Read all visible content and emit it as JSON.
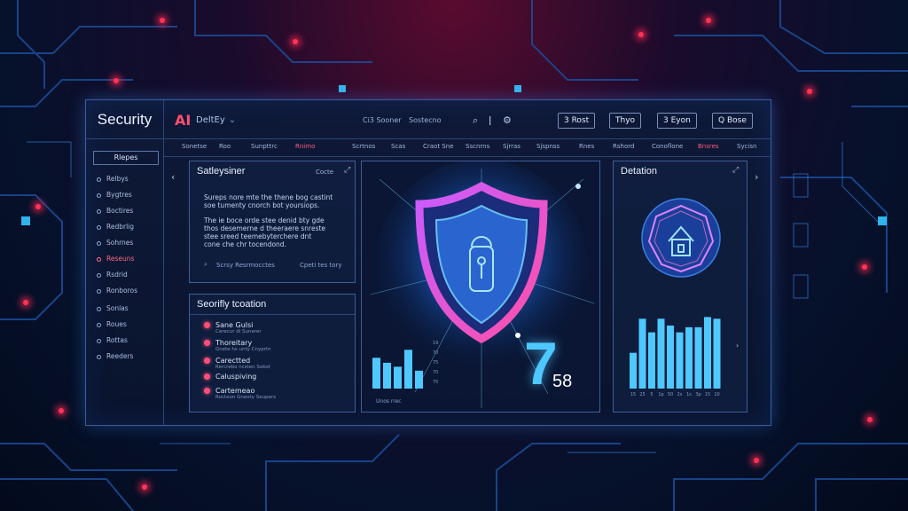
{
  "app": {
    "title": "Security",
    "ai_badge": "AI",
    "department": "DeltEy"
  },
  "topbar": {
    "mini_labels": [
      "Ci3 Sooner",
      "Sostecno"
    ],
    "icons": [
      "search-icon",
      "info-icon",
      "settings-icon"
    ],
    "buttons": [
      "3 Rost",
      "Thyo",
      "3 Eyon",
      "Q Bose"
    ]
  },
  "nav": {
    "items": [
      "Sonetse",
      "Roo",
      "Sunpttrc",
      "Rnimo",
      "Scrtnos",
      "Scas",
      "Craot Sne",
      "Sscnrns",
      "Sjrras",
      "Sjspnss",
      "Rnes",
      "Rshord",
      "Conoflone",
      "Bnsres",
      "Sycisn"
    ],
    "active_index": 3
  },
  "sidebar": {
    "header": "Rlepes",
    "items": [
      "Relbys",
      "Bygtres",
      "Boctires",
      "Redbrlig",
      "Sohrnes",
      "Reseuns",
      "Rsdrid",
      "Ronboros",
      "Sonlas",
      "Roues",
      "Rottas",
      "Reeders"
    ],
    "active_index": 5
  },
  "safety_panel": {
    "title": "Satleysiner",
    "action": "Cocte",
    "paragraph_1": "Sureps nore mte the thene bog castint\nsoe tumenty cnorch bot yoursiops.",
    "paragraph_2": "The ie boce orde stee denid bty gde\nthos desemerne d theeraere snreste\nstee sreed teemebyterchere dnt\ncone che chr tocendond.",
    "footer_left": "Scrsy Resrmocctes",
    "footer_right": "Cpeti tes tory"
  },
  "sec_panel": {
    "title": "Seorifly tcoation",
    "events": [
      {
        "label": "Sane Gulsi",
        "sub": "Cerecur di Sunerer"
      },
      {
        "label": "Thoreitary",
        "sub": "Gnete hs unty Cnyprtn"
      },
      {
        "label": "Carectted",
        "sub": "Rercrebo ncsten Sokot"
      },
      {
        "label": "Caluspiving",
        "sub": ""
      },
      {
        "label": "Cartemeao",
        "sub": "Rocteon Gneoty Seupers"
      }
    ]
  },
  "center": {
    "big_number": "7",
    "small_number": "58",
    "mini_bars": [
      0.62,
      0.52,
      0.44,
      0.78,
      0.36
    ],
    "mini_bar_labels": [
      "19",
      "70",
      "75",
      "70",
      "75"
    ],
    "mini_caption": "Unos rrec"
  },
  "detection": {
    "title": "Detation",
    "bars": [
      0.42,
      0.82,
      0.66,
      0.82,
      0.74,
      0.66,
      0.72,
      0.72,
      0.84,
      0.82
    ],
    "bar_labels": [
      "15",
      "25",
      "5",
      "1p",
      "50",
      "2s",
      "1s",
      "3p",
      "15",
      "10"
    ]
  },
  "colors": {
    "accent": "#4ec8ff",
    "alert": "#ff4f7a",
    "border": "#3e5e98"
  }
}
